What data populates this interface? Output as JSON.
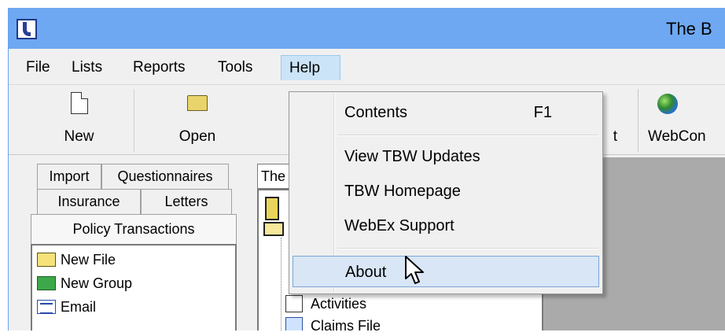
{
  "window": {
    "title": "The B",
    "accent_color": "#6ea8f2"
  },
  "menubar": {
    "items": [
      "File",
      "Lists",
      "Reports",
      "Tools",
      "Help"
    ],
    "active": "Help"
  },
  "toolbar": {
    "new_label": "New",
    "open_label": "Open",
    "partial_label": "t",
    "webcon_label": "WebCon"
  },
  "leftpanel": {
    "tabs": {
      "import": "Import",
      "questionnaires": "Questionnaires",
      "insurance": "Insurance",
      "letters": "Letters",
      "policy_transactions": "Policy Transactions"
    },
    "list_items": [
      "New File",
      "New Group",
      "Email"
    ]
  },
  "centerpanel": {
    "combo_value": "The",
    "tree_items": [
      "Activities",
      "Claims File"
    ]
  },
  "help_menu": {
    "contents": {
      "label": "Contents",
      "shortcut": "F1"
    },
    "view_updates": "View TBW Updates",
    "homepage": "TBW Homepage",
    "webex_support": "WebEx Support",
    "about": "About",
    "highlight_color": "#d8e6f6"
  },
  "icons": {
    "app": "app-logo-icon",
    "new": "document-icon",
    "open": "folder-open-icon",
    "webcon": "globe-icon",
    "cursor": "mouse-pointer-icon"
  }
}
